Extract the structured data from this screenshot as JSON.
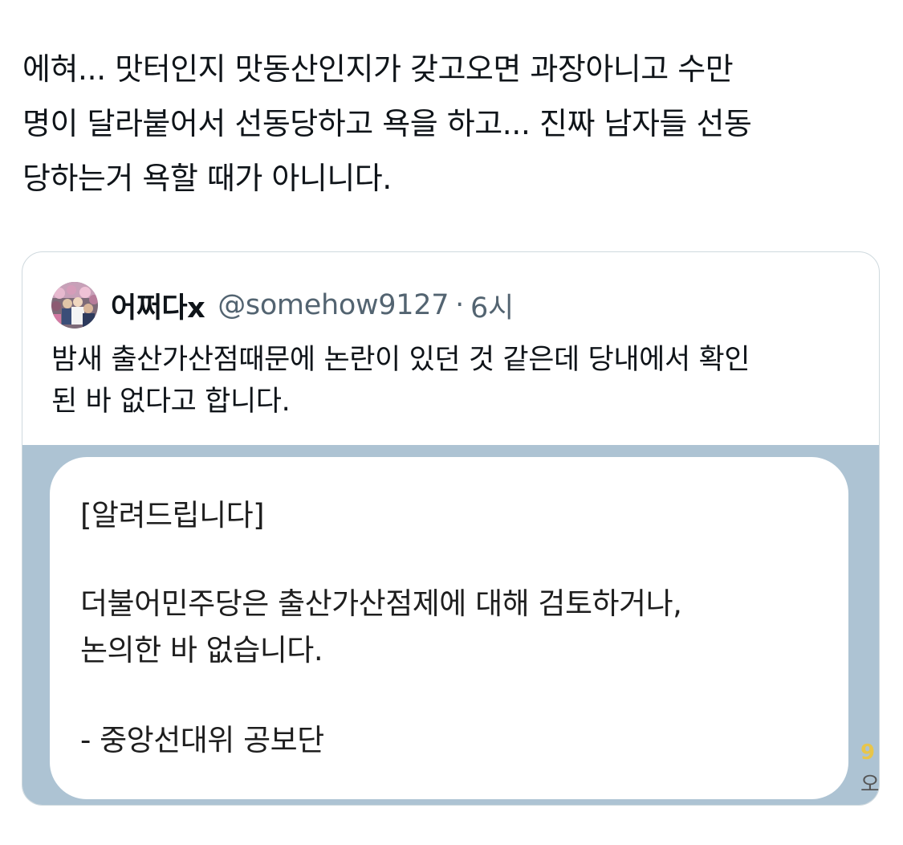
{
  "tweet": {
    "text": "에혀... 맛터인지 맛동산인지가 갖고오면 과장아니고 수만\n명이 달라붙어서 선동당하고 욕을 하고... 진짜 남자들 선동\n당하는거 욕할 때가 아니니다."
  },
  "quote": {
    "author_name": "어쩌다x",
    "handle": "@somehow9127",
    "separator": "·",
    "time": "6시",
    "text": "밤새 출산가산점때문에 논란이 있던 것 같은데 당내에서 확인\n된 바 없다고 합니다.",
    "avatar_icon": "crowd-photo-avatar",
    "media": {
      "background": "#adc3d3",
      "notice_title": "[알려드립니다]",
      "notice_line1": "더불어민주당은 출산가산점제에 대해 검토하거나,",
      "notice_line2": "논의한 바 없습니다.",
      "notice_signature": "- 중앙선대위 공보단",
      "side_fragment_top": "9",
      "side_fragment_bottom": "오"
    }
  },
  "colors": {
    "text_primary": "#0f1419",
    "text_secondary": "#536471",
    "card_border": "#cfd9de",
    "side_yellow": "#e8c54a"
  }
}
